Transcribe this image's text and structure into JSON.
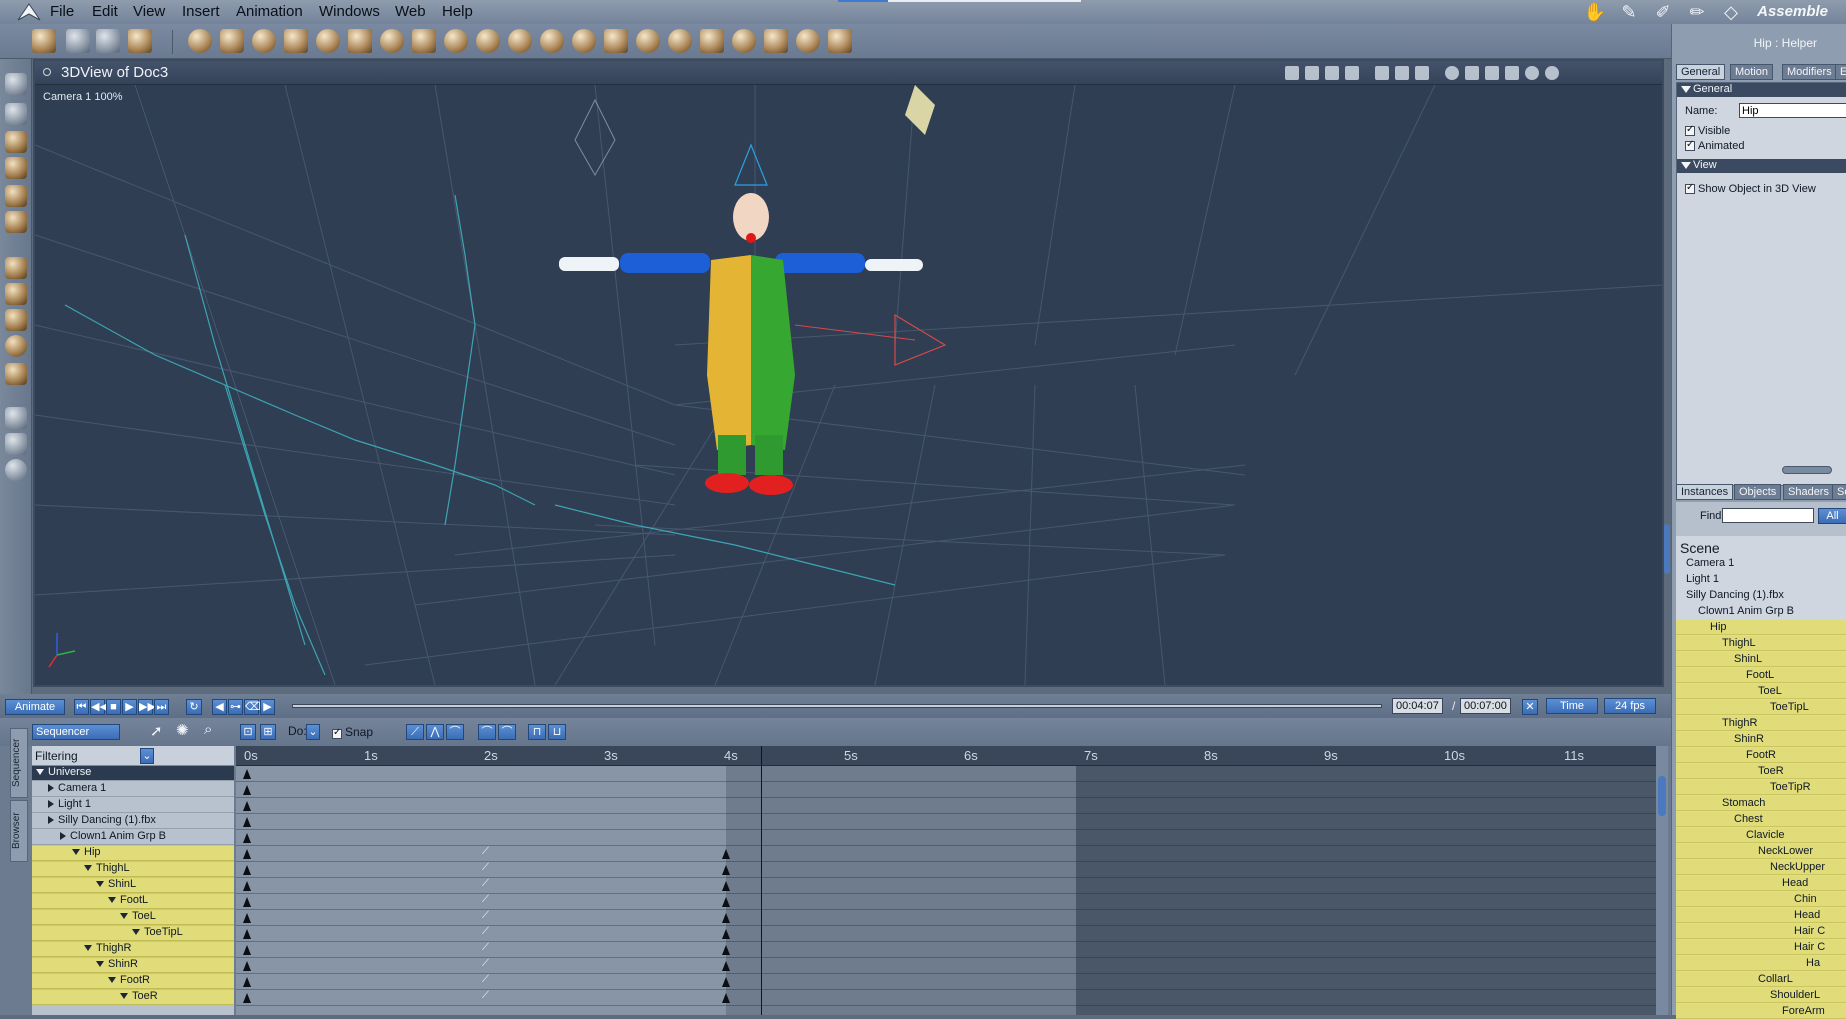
{
  "menubar": {
    "items": [
      "File",
      "Edit",
      "View",
      "Insert",
      "Animation",
      "Windows",
      "Web",
      "Help"
    ],
    "room": "Assemble"
  },
  "view": {
    "title": "3DView of Doc3",
    "camera_label": "Camera 1 100%"
  },
  "sidebar": {
    "title": "Hip : Helper",
    "tabs": [
      "General",
      "Motion",
      "Modifiers",
      "Eff"
    ],
    "general_header": "General",
    "name_label": "Name:",
    "name_value": "Hip",
    "visible_label": "Visible",
    "animated_label": "Animated",
    "view_header": "View",
    "show_label": "Show Object in 3D View",
    "lower_tabs": [
      "Instances",
      "Objects",
      "Shaders",
      "Sou"
    ],
    "find_label": "Find:",
    "find_value": "",
    "all_label": "All",
    "scene_header": "Scene",
    "scene_items": [
      {
        "label": "Camera 1",
        "indent": 0,
        "y": false
      },
      {
        "label": "Light 1",
        "indent": 0,
        "y": false
      },
      {
        "label": "Silly Dancing (1).fbx",
        "indent": 0,
        "y": false
      },
      {
        "label": "Clown1 Anim Grp B",
        "indent": 1,
        "y": false
      },
      {
        "label": "Hip",
        "indent": 2,
        "y": true
      },
      {
        "label": "ThighL",
        "indent": 3,
        "y": true
      },
      {
        "label": "ShinL",
        "indent": 4,
        "y": true
      },
      {
        "label": "FootL",
        "indent": 5,
        "y": true
      },
      {
        "label": "ToeL",
        "indent": 6,
        "y": true
      },
      {
        "label": "ToeTipL",
        "indent": 7,
        "y": true
      },
      {
        "label": "ThighR",
        "indent": 3,
        "y": true
      },
      {
        "label": "ShinR",
        "indent": 4,
        "y": true
      },
      {
        "label": "FootR",
        "indent": 5,
        "y": true
      },
      {
        "label": "ToeR",
        "indent": 6,
        "y": true
      },
      {
        "label": "ToeTipR",
        "indent": 7,
        "y": true
      },
      {
        "label": "Stomach",
        "indent": 3,
        "y": true
      },
      {
        "label": "Chest",
        "indent": 4,
        "y": true
      },
      {
        "label": "Clavicle",
        "indent": 5,
        "y": true
      },
      {
        "label": "NeckLower",
        "indent": 6,
        "y": true
      },
      {
        "label": "NeckUpper",
        "indent": 7,
        "y": true
      },
      {
        "label": "Head",
        "indent": 8,
        "y": true
      },
      {
        "label": "Chin",
        "indent": 9,
        "y": true
      },
      {
        "label": "Head",
        "indent": 9,
        "y": true
      },
      {
        "label": "Hair C",
        "indent": 9,
        "y": true
      },
      {
        "label": "Hair C",
        "indent": 9,
        "y": true
      },
      {
        "label": "Ha",
        "indent": 10,
        "y": true
      },
      {
        "label": "CollarL",
        "indent": 6,
        "y": true
      },
      {
        "label": "ShoulderL",
        "indent": 7,
        "y": true
      },
      {
        "label": "ForeArm",
        "indent": 8,
        "y": true
      }
    ]
  },
  "timebar": {
    "animate": "Animate",
    "current_time": "00:04:07",
    "total_time": "00:07:00",
    "time_mode": "Time",
    "fps": "24 fps"
  },
  "sequencer": {
    "mode": "Sequencer",
    "do_label": "Do:",
    "snap_label": "Snap",
    "filtering": "Filtering",
    "side_tabs": [
      "Sequencer",
      "Browser"
    ],
    "ruler": [
      "0s",
      "1s",
      "2s",
      "3s",
      "4s",
      "5s",
      "6s",
      "7s",
      "8s",
      "9s",
      "10s",
      "11s"
    ],
    "tracks": [
      {
        "label": "Universe",
        "indent": 0,
        "type": "header"
      },
      {
        "label": "Camera 1",
        "indent": 1,
        "type": "plain"
      },
      {
        "label": "Light 1",
        "indent": 1,
        "type": "plain"
      },
      {
        "label": "Silly Dancing (1).fbx",
        "indent": 1,
        "type": "plain"
      },
      {
        "label": "Clown1 Anim Grp B",
        "indent": 2,
        "type": "plain"
      },
      {
        "label": "Hip",
        "indent": 3,
        "type": "y"
      },
      {
        "label": "ThighL",
        "indent": 4,
        "type": "y"
      },
      {
        "label": "ShinL",
        "indent": 5,
        "type": "y"
      },
      {
        "label": "FootL",
        "indent": 6,
        "type": "y"
      },
      {
        "label": "ToeL",
        "indent": 7,
        "type": "y"
      },
      {
        "label": "ToeTipL",
        "indent": 8,
        "type": "y"
      },
      {
        "label": "ThighR",
        "indent": 4,
        "type": "y"
      },
      {
        "label": "ShinR",
        "indent": 5,
        "type": "y"
      },
      {
        "label": "FootR",
        "indent": 6,
        "type": "y"
      },
      {
        "label": "ToeR",
        "indent": 7,
        "type": "y"
      }
    ]
  }
}
